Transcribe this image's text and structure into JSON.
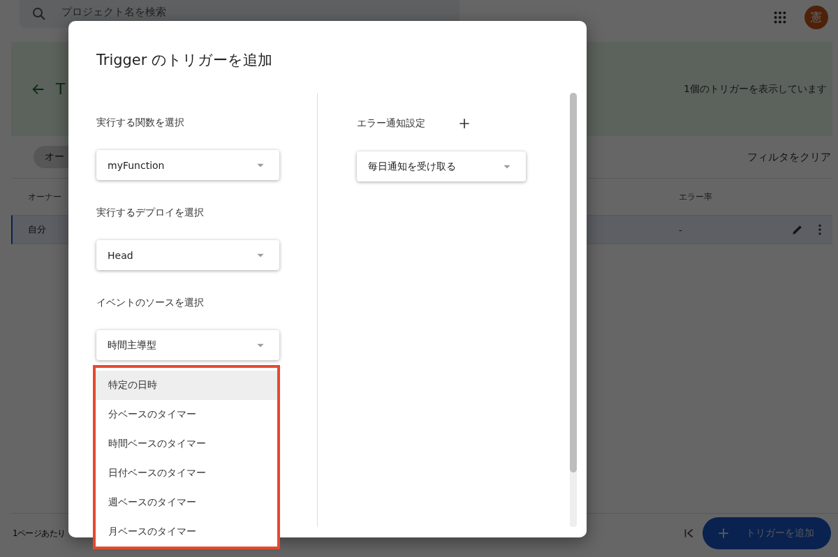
{
  "background": {
    "search": {
      "placeholder": "プロジェクト名を検索"
    },
    "avatar": "憲",
    "header": {
      "title": "T",
      "count": "1個のトリガーを表示しています"
    },
    "filter_chip": "オー",
    "clear_filter": "フィルタをクリア",
    "table": {
      "columns": [
        "オーナー",
        "エラー率"
      ],
      "rows": [
        {
          "cells": [
            "自分",
            "-"
          ],
          "selected": true
        }
      ]
    },
    "footer": {
      "per_page": "1ページあたり"
    },
    "fab": "トリガーを追加"
  },
  "dialog": {
    "title": "Trigger のトリガーを追加",
    "fields": [
      {
        "label": "実行する関数を選択",
        "value": "myFunction"
      },
      {
        "label": "実行するデプロイを選択",
        "value": "Head"
      },
      {
        "label": "イベントのソースを選択",
        "value": "時間主導型"
      }
    ],
    "error_notification": {
      "label": "エラー通知設定",
      "value": "毎日通知を受け取る"
    },
    "menu": {
      "items": [
        {
          "label": "特定の日時",
          "selected": true
        },
        {
          "label": "分ベースのタイマー",
          "selected": false
        },
        {
          "label": "時間ベースのタイマー",
          "selected": false
        },
        {
          "label": "日付ベースのタイマー",
          "selected": false
        },
        {
          "label": "週ベースのタイマー",
          "selected": false
        },
        {
          "label": "月ベースのタイマー",
          "selected": false
        }
      ]
    }
  }
}
